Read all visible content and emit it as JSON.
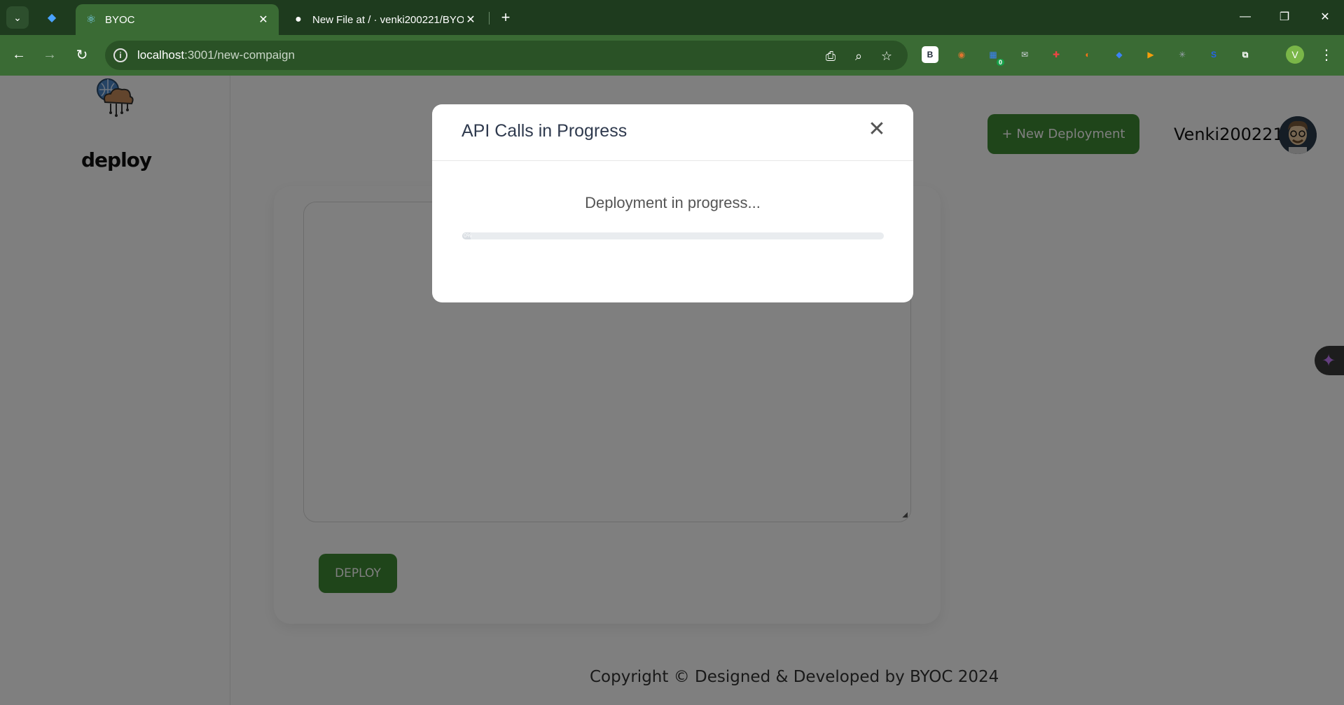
{
  "browser": {
    "tabs": [
      {
        "title": "BYOC",
        "icon": "react-icon",
        "active": true
      },
      {
        "title": "New File at / · venki200221/BYOC",
        "icon": "github-icon",
        "active": false
      }
    ],
    "url_host": "localhost",
    "url_path": ":3001/new-compaign",
    "profile_initial": "V",
    "extensions": [
      {
        "name": "b-extension-icon",
        "glyph": "B",
        "color": "#2563eb"
      },
      {
        "name": "color-wheel-extension-icon",
        "glyph": "◉",
        "color": "#e0752f"
      },
      {
        "name": "blue-badge-extension-icon",
        "glyph": "▦",
        "color": "#3b82f6",
        "badge": "0"
      },
      {
        "name": "mail-extension-icon",
        "glyph": "✉",
        "color": "#d1d5db"
      },
      {
        "name": "gmail-red-extension-icon",
        "glyph": "✚",
        "color": "#ef4444"
      },
      {
        "name": "firefox-like-extension-icon",
        "glyph": "◐",
        "color": "#f97316"
      },
      {
        "name": "diamond-extension-icon",
        "glyph": "◆",
        "color": "#3b82f6"
      },
      {
        "name": "play-extension-icon",
        "glyph": "▶",
        "color": "#f59e0b"
      },
      {
        "name": "sparkle-extension-icon",
        "glyph": "✳",
        "color": "#9ca3af"
      },
      {
        "name": "s-extension-icon",
        "glyph": "S",
        "color": "#2563eb"
      },
      {
        "name": "puzzle-extension-icon",
        "glyph": "⧉",
        "color": "#ffffff"
      }
    ]
  },
  "sidebar": {
    "logo_text": "deploy"
  },
  "header": {
    "new_deployment_label": "+ New Deployment",
    "username": "Venki200221"
  },
  "main": {
    "deploy_label": "DEPLOY"
  },
  "footer": {
    "copyright": "Copyright © Designed & Developed by BYOC 2024"
  },
  "modal": {
    "title": "API Calls in Progress",
    "status": "Deployment in progress...",
    "progress_percent": 2,
    "progress_label": "0%"
  },
  "colors": {
    "brand_green": "#3f8a35",
    "chrome_dark": "#1e3b1e",
    "chrome_toolbar": "#3a6b34"
  }
}
